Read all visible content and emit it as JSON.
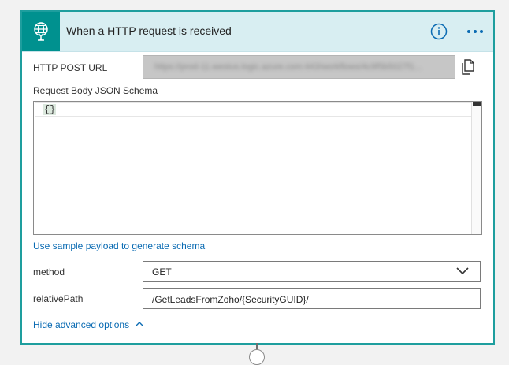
{
  "trigger": {
    "title": "When a HTTP request is received",
    "icon": "globe-icon",
    "accent_color": "#00918f",
    "header_bg": "#d8eef2"
  },
  "url_field": {
    "label": "HTTP POST URL",
    "value": "https://prod-11.westus.logic.azure.com:443/workflows/4c9f5b5027f1..."
  },
  "schema": {
    "label": "Request Body JSON Schema",
    "content": "{}"
  },
  "sample_link": "Use sample payload to generate schema",
  "method": {
    "label": "method",
    "value": "GET"
  },
  "relative_path": {
    "label": "relativePath",
    "value": "/GetLeadsFromZoho/{SecurityGUID}/"
  },
  "advanced_link": "Hide advanced options",
  "link_color": "#0a6bb3"
}
